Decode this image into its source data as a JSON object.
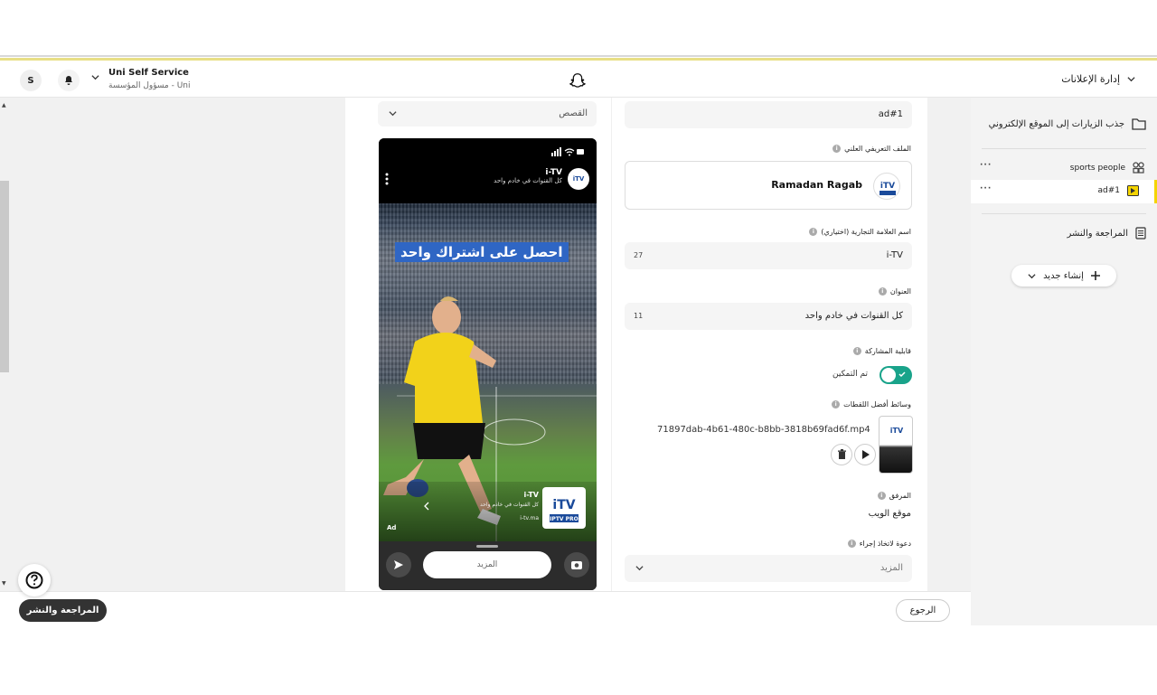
{
  "header": {
    "avatar_initial": "S",
    "org_name": "Uni Self Service",
    "org_sub": "مسؤول المؤسسة - Uni",
    "ads_manager": "إدارة الإعلانات"
  },
  "preview": {
    "format_select": "القصص",
    "phone": {
      "brand": "i-TV",
      "brand_sub": "كل القنوات في خادم واحد",
      "headline_banner": "احصل على اشتراك واحد",
      "card_brand": "i-TV",
      "card_sub": "كل القنوات في خادم واحد",
      "card_url": "i-tv.ma",
      "ad_label": "Ad",
      "more_button": "المزيد"
    }
  },
  "form": {
    "ad_name": "ad#1",
    "public_profile_label": "الملف التعريفي العلني",
    "public_profile_name": "Ramadan Ragab",
    "brand_label": "اسم العلامة التجارية (اختياري)",
    "brand_value": "i-TV",
    "brand_count": "27",
    "headline_label": "العنوان",
    "headline_value": "كل القنوات في خادم واحد",
    "headline_count": "11",
    "shareable_label": "قابلية المشاركة",
    "shareable_status": "تم التمكين",
    "spotlight_label": "وسائط أفضل اللقطات",
    "media_filename": "71897dab-4b61-480c-b8bb-3818b69fad6f.mp4",
    "attachment_label": "المرفق",
    "attachment_value": "موقع الويب",
    "cta_label": "دعوة لاتخاذ إجراء",
    "cta_value": "المزيد"
  },
  "sidebar": {
    "campaign": "جذب الزيارات إلى الموقع الإلكتروني",
    "ad_set": "sports people",
    "ad": "ad#1",
    "review": "المراجعة والنشر",
    "new_button": "إنشاء جديد"
  },
  "footer": {
    "review_publish": "المراجعة والنشر",
    "back": "الرجوع"
  },
  "colors": {
    "accent_yellow": "#f4d400",
    "toggle_green": "#19a38a",
    "banner_blue": "#2f66c4"
  }
}
